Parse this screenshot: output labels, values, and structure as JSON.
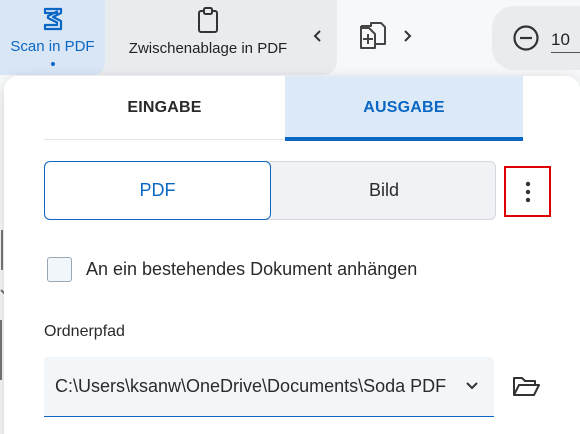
{
  "toolbar": {
    "scan_label": "Scan in PDF",
    "clipboard_label": "Zwischenablage in PDF",
    "zoom_value": "10",
    "icons": {
      "scan": "scanner-icon",
      "clipboard": "clipboard-icon",
      "prev": "chevron-left-icon",
      "add_doc": "add-document-icon",
      "next": "chevron-right-icon",
      "zoom_out": "zoom-out-icon"
    }
  },
  "panel": {
    "tabs": [
      {
        "label": "EINGABE",
        "active": false
      },
      {
        "label": "AUSGABE",
        "active": true
      }
    ],
    "format": {
      "options": [
        "PDF",
        "Bild"
      ],
      "selected": "PDF"
    },
    "more_icon": "more-vertical-icon",
    "append_checkbox": {
      "label": "An ein bestehendes Dokument anhängen",
      "checked": false
    },
    "path": {
      "label": "Ordnerpfad",
      "value": "C:\\Users\\ksanw\\OneDrive\\Documents\\Soda PDF",
      "folder_icon": "folder-open-icon"
    }
  },
  "colors": {
    "accent": "#0a67c4",
    "active_tab_bg": "#dce9f7",
    "highlight_border": "#e00000"
  }
}
